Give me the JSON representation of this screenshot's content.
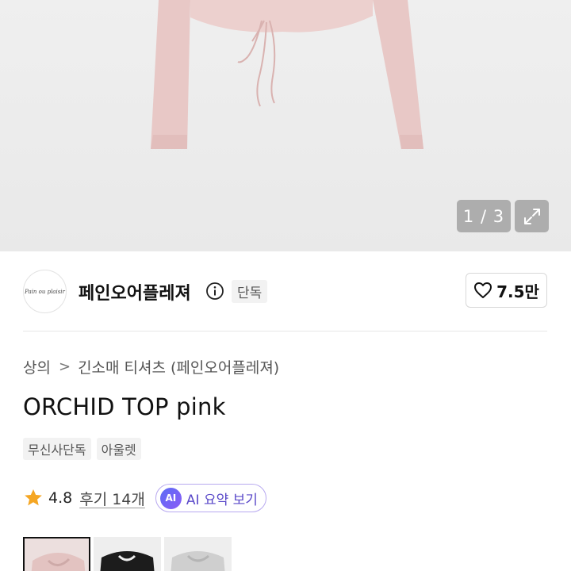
{
  "gallery": {
    "counter": "1 / 3",
    "icons": {
      "expand": "expand-arrows-icon"
    }
  },
  "brand": {
    "logo_text": "Pain ou plaisir",
    "name": "페인오어플레져",
    "exclusive_badge": "단독",
    "like_count": "7.5만",
    "icons": {
      "info": "info-circle-icon",
      "like": "heart-outline-icon"
    }
  },
  "breadcrumb": {
    "category": "상의",
    "subcategory": "긴소매 티셔츠 (페인오어플레져)",
    "separator": ">"
  },
  "product": {
    "title": "ORCHID TOP pink",
    "tags": [
      "무신사단독",
      "아울렛"
    ]
  },
  "rating": {
    "value": "4.8",
    "reviews_label": "후기 14개",
    "ai_chip": "AI",
    "ai_summary_label": "AI 요약 보기",
    "star_color": "#f5a623"
  },
  "thumbnails": [
    {
      "color": "pink",
      "selected": true
    },
    {
      "color": "black",
      "selected": false
    },
    {
      "color": "gray",
      "selected": false
    }
  ]
}
